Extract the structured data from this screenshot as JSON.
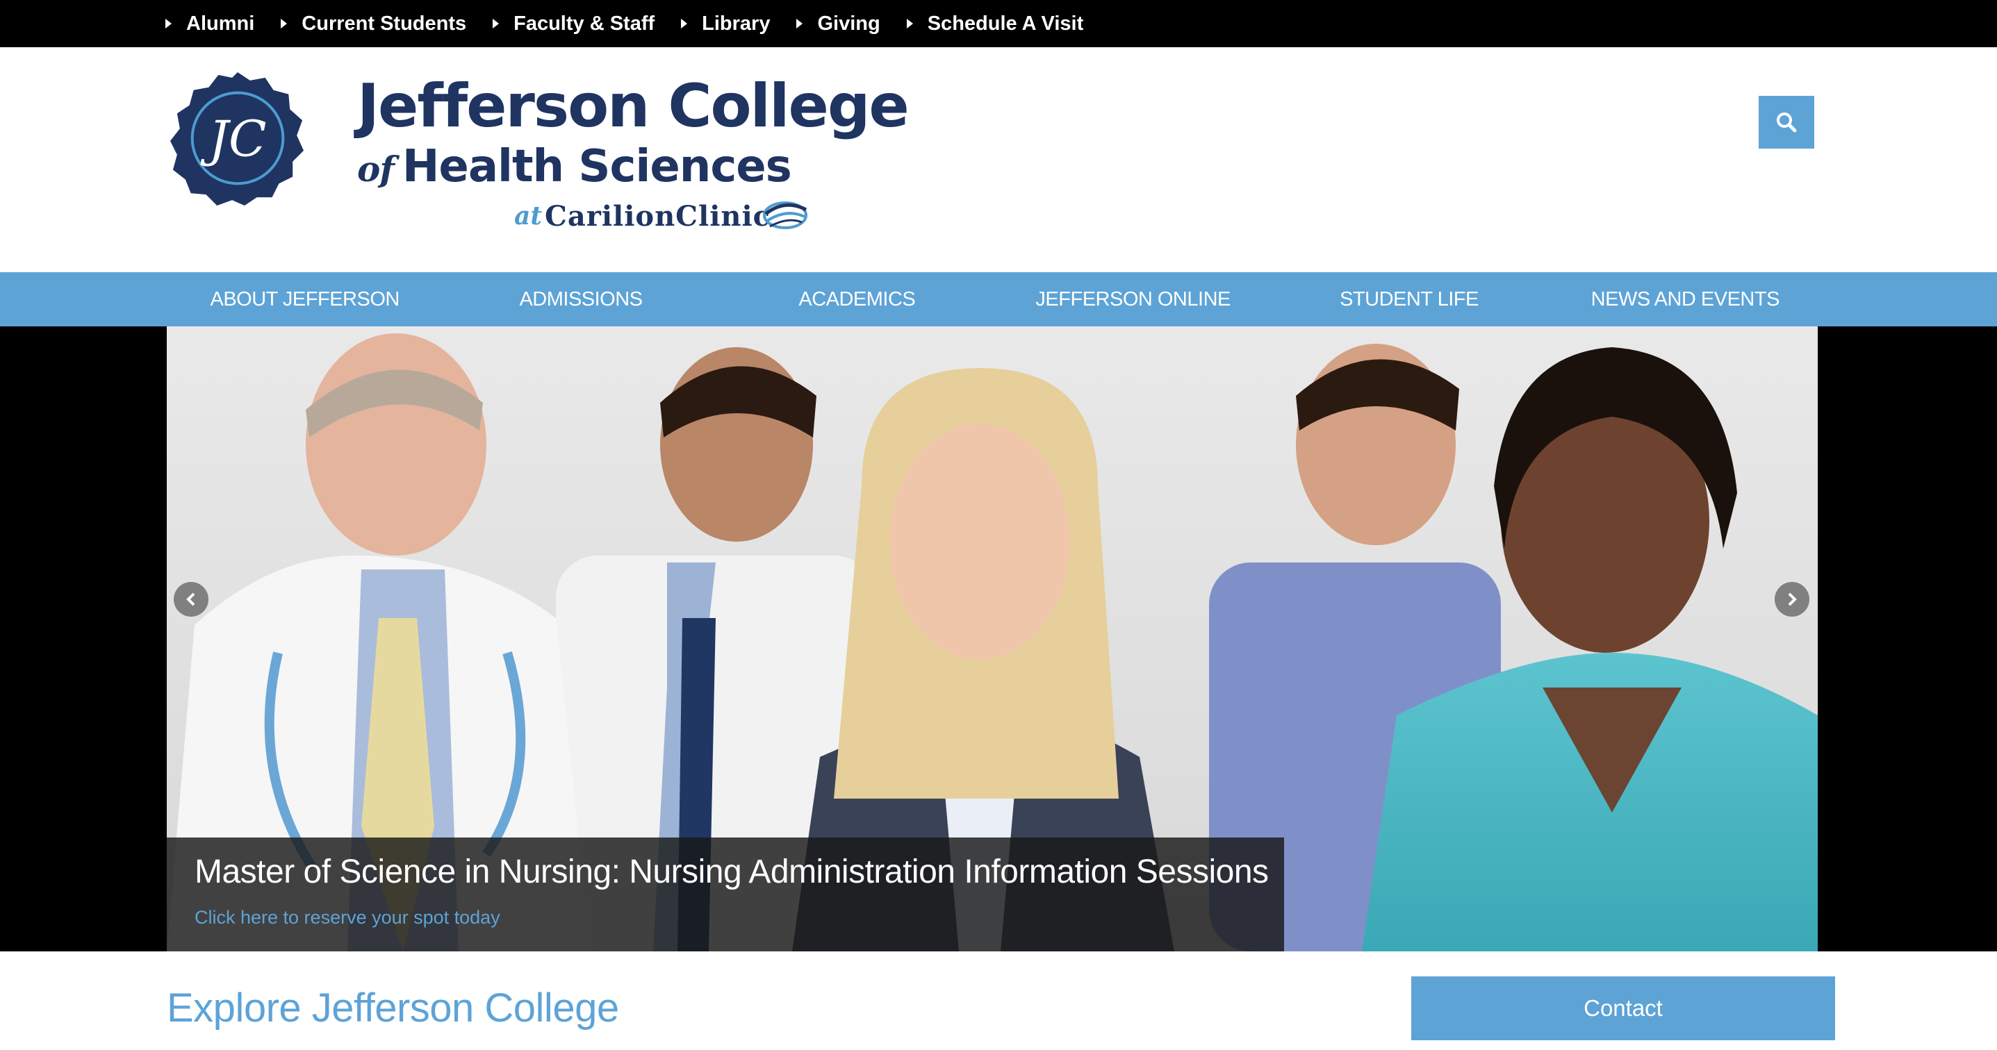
{
  "topbar": {
    "links": [
      "Alumni",
      "Current Students",
      "Faculty & Staff",
      "Library",
      "Giving",
      "Schedule A Visit"
    ]
  },
  "header": {
    "logo_monogram": "JC",
    "brand_line1": "Jefferson College",
    "brand_of": "of",
    "brand_line2": "Health Sciences",
    "brand_at": "at",
    "brand_partner": "CarilionClinic",
    "search_icon": "search-icon"
  },
  "nav": {
    "items": [
      "ABOUT JEFFERSON",
      "ADMISSIONS",
      "ACADEMICS",
      "JEFFERSON ONLINE",
      "STUDENT LIFE",
      "NEWS AND EVENTS"
    ]
  },
  "hero": {
    "prev_icon": "chevron-left-icon",
    "next_icon": "chevron-right-icon",
    "caption_title": "Master of Science in Nursing: Nursing Administration Information Sessions",
    "caption_link": "Click here to reserve your spot today"
  },
  "explore": {
    "heading": "Explore Jefferson College"
  },
  "contact": {
    "label": "Contact"
  },
  "colors": {
    "accent": "#5da3d6",
    "brand_navy": "#1f3461",
    "topbar_bg": "#000000"
  }
}
